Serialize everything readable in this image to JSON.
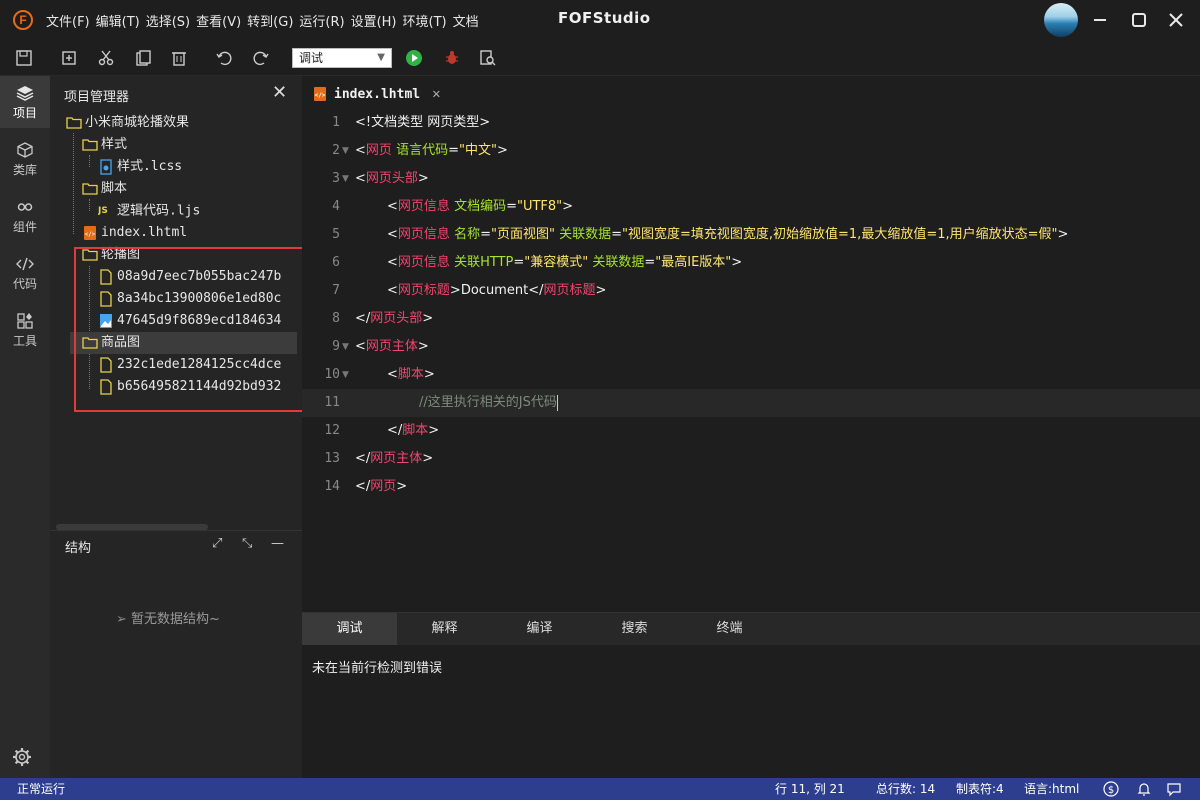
{
  "titlebar": {
    "menu": [
      "文件(F)",
      "编辑(T)",
      "选择(S)",
      "查看(V)",
      "转到(G)",
      "运行(R)",
      "设置(H)",
      "环境(T)",
      "文档"
    ],
    "app_title": "FOFStudio",
    "logo_letter": "F"
  },
  "toolbar": {
    "icons": [
      "save-icon",
      "new-file-icon",
      "cut-icon",
      "paste-icon",
      "delete-icon",
      "undo-icon",
      "redo-icon",
      "run-icon",
      "debug-bug-icon",
      "search-doc-icon"
    ],
    "mode_value": "调试"
  },
  "activity": {
    "items": [
      {
        "label": "项目",
        "icon": "layers-icon"
      },
      {
        "label": "类库",
        "icon": "cube-icon"
      },
      {
        "label": "组件",
        "icon": "link-icon"
      },
      {
        "label": "代码",
        "icon": "code-icon"
      },
      {
        "label": "工具",
        "icon": "grid-icon"
      }
    ]
  },
  "explorer": {
    "title": "项目管理器",
    "root": "小米商城轮播效果",
    "folder_styles": "样式",
    "file_styles": "样式.lcss",
    "folder_scripts": "脚本",
    "file_scripts": "逻辑代码.ljs",
    "file_index": "index.lhtml",
    "folder_carousel": "轮播图",
    "carousel_files": [
      "08a9d7eec7b055bac247b",
      "8a34bc13900806e1ed80c",
      "47645d9f8689ecd184634"
    ],
    "folder_products": "商品图",
    "product_files": [
      "232c1ede1284125cc4dce",
      "b656495821144d92bd932"
    ]
  },
  "structure": {
    "title": "结构",
    "empty": "暂无数据结构~"
  },
  "editor": {
    "tab": "index.lhtml",
    "lines": [
      "1",
      "2",
      "3",
      "4",
      "5",
      "6",
      "7",
      "8",
      "9",
      "10",
      "11",
      "12",
      "13",
      "14"
    ],
    "code": {
      "l1": "<!文档类型 网页类型>",
      "l2_open": "<",
      "l2_tag": "网页",
      "l2_attr": "语言代码",
      "l2_eq": "=",
      "l2_val": "\"中文\"",
      "l2_close": ">",
      "l3_tag": "网页头部",
      "l4_tag": "网页信息",
      "l4_attr": "文档编码",
      "l4_val": "\"UTF8\"",
      "l5_tag": "网页信息",
      "l5_attr1": "名称",
      "l5_val1": "\"页面视图\"",
      "l5_attr2": "关联数据",
      "l5_val2": "\"视图宽度=填充视图宽度,初始缩放值=1,最大缩放值=1,用户缩放状态=假\"",
      "l6_tag": "网页信息",
      "l6_attr1": "关联HTTP",
      "l6_val1": "\"兼容模式\"",
      "l6_attr2": "关联数据",
      "l6_val2": "\"最高IE版本\"",
      "l7_tag": "网页标题",
      "l7_text": "Document",
      "l7_endtag": "网页标题",
      "l8_tag": "网页头部",
      "l9_tag": "网页主体",
      "l10_tag": "脚本",
      "l11_comment": "//这里执行相关的JS代码",
      "l12_tag": "脚本",
      "l13_tag": "网页主体",
      "l14_tag": "网页"
    }
  },
  "panel": {
    "tabs": [
      "调试",
      "解释",
      "编译",
      "搜索",
      "终端"
    ],
    "message": "未在当前行检测到错误"
  },
  "status": {
    "left": "正常运行",
    "position": "行 11, 列 21",
    "total_lines": "总行数: 14",
    "tab_size": "制表符:4",
    "language": "语言:html"
  },
  "colors": {
    "status_bar": "#2d3e8f",
    "tag": "#f0466e",
    "attribute": "#a6e22e",
    "string": "#ffe66d",
    "highlight_box": "#e03a3a",
    "logo": "#e36c19"
  }
}
